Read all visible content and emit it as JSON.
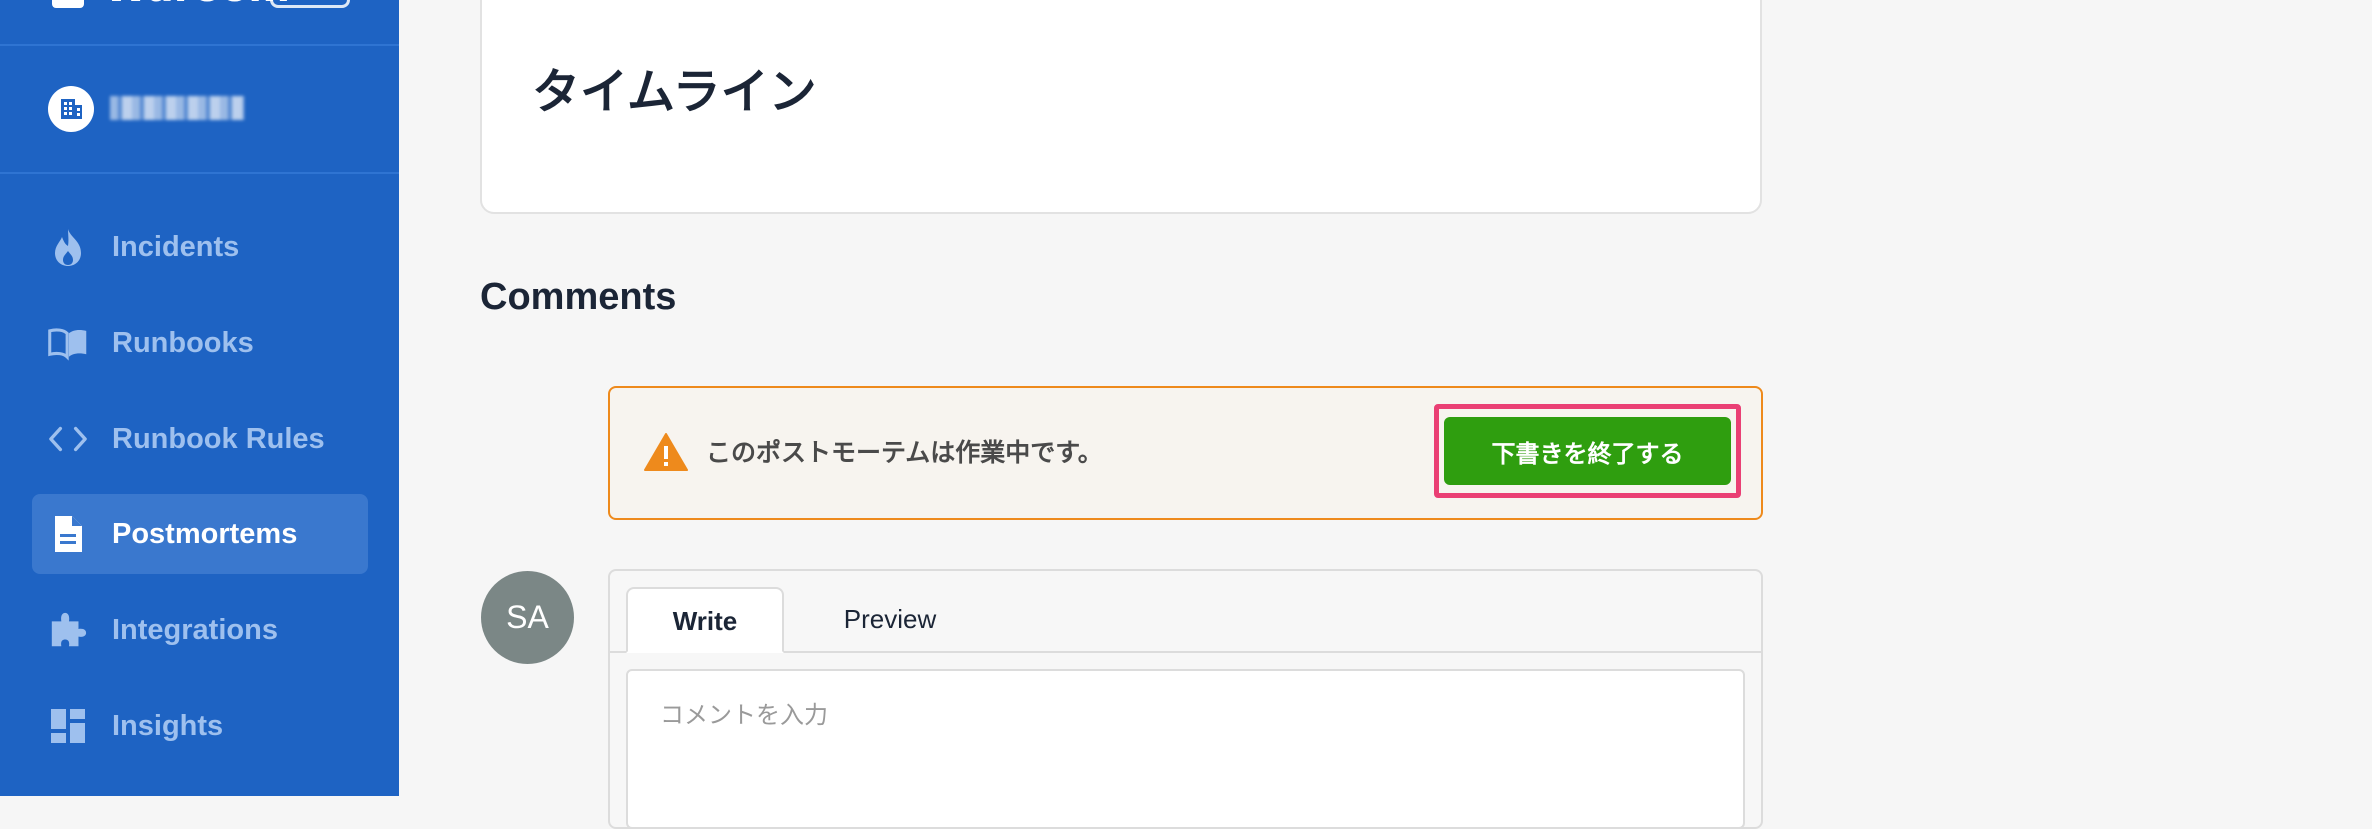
{
  "sidebar": {
    "brand": {
      "name": "Waroom"
    },
    "organization": {
      "name": ""
    },
    "items": [
      {
        "label": "Incidents",
        "icon": "flame-icon",
        "active": false
      },
      {
        "label": "Runbooks",
        "icon": "book-icon",
        "active": false
      },
      {
        "label": "Runbook Rules",
        "icon": "code-icon",
        "active": false
      },
      {
        "label": "Postmortems",
        "icon": "document-icon",
        "active": true
      },
      {
        "label": "Integrations",
        "icon": "puzzle-icon",
        "active": false
      },
      {
        "label": "Insights",
        "icon": "dashboard-icon",
        "active": false
      }
    ]
  },
  "main": {
    "timeline_title": "タイムライン",
    "comments_heading": "Comments",
    "alert": {
      "message": "このポストモーテムは作業中です。",
      "button_label": "下書きを終了する"
    },
    "avatar_initials": "SA",
    "editor": {
      "tabs": [
        {
          "label": "Write",
          "active": true
        },
        {
          "label": "Preview",
          "active": false
        }
      ],
      "placeholder": "コメントを入力",
      "value": ""
    }
  },
  "colors": {
    "sidebar_bg": "#1e63c3",
    "nav_active_bg": "#3a78ce",
    "alert_border": "#ee8a1c",
    "primary_button": "#2f9e0f",
    "highlight": "#ea3f74"
  }
}
